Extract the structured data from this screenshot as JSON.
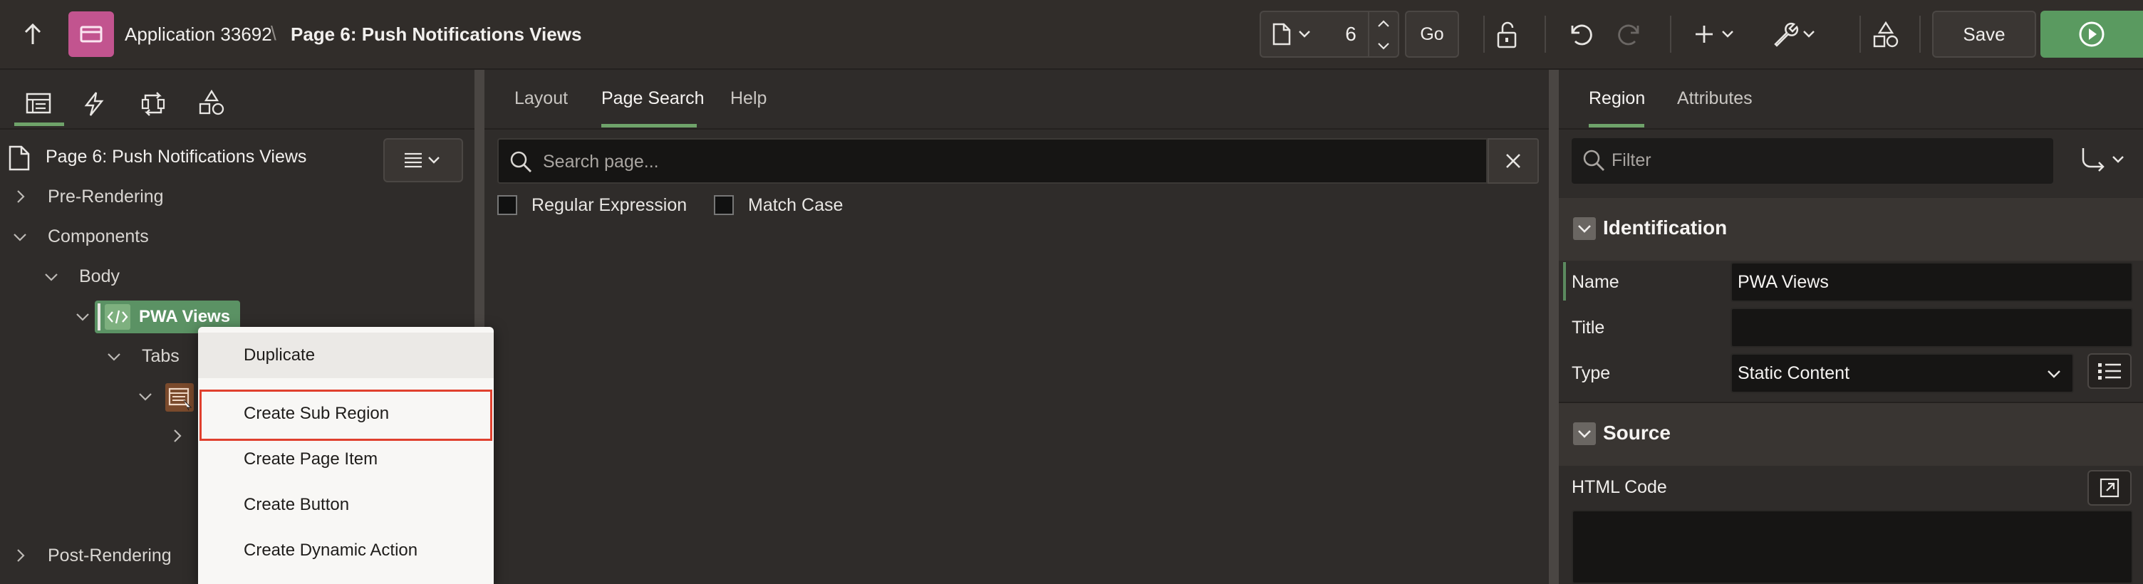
{
  "toolbar": {
    "app_title": "Application 33692",
    "breadcrumb_sep": "\\",
    "page_title": "Page 6: Push Notifications Views",
    "page_number": "6",
    "go_label": "Go",
    "save_label": "Save"
  },
  "left": {
    "tabs": [
      "rendering-icon",
      "dynamic-actions-icon",
      "processing-icon",
      "shared-components-icon"
    ],
    "page_node": "Page 6: Push Notifications Views",
    "tree": {
      "pre_rendering": "Pre-Rendering",
      "components": "Components",
      "body": "Body",
      "pwa_views": "PWA Views",
      "tabs": "Tabs",
      "post_rendering": "Post-Rendering"
    }
  },
  "context_menu": {
    "items": [
      "Duplicate",
      "Create Sub Region",
      "Create Page Item",
      "Create Button",
      "Create Dynamic Action"
    ],
    "highlighted": "Create Sub Region"
  },
  "middle": {
    "tabs": [
      "Layout",
      "Page Search",
      "Help"
    ],
    "active_tab": "Page Search",
    "search_placeholder": "Search page...",
    "regex_label": "Regular Expression",
    "match_case_label": "Match Case"
  },
  "right": {
    "tabs": [
      "Region",
      "Attributes"
    ],
    "active_tab": "Region",
    "filter_placeholder": "Filter",
    "identification": {
      "title": "Identification",
      "name_label": "Name",
      "name_value": "PWA Views",
      "title_label": "Title",
      "title_value": "",
      "type_label": "Type",
      "type_value": "Static Content"
    },
    "source": {
      "title": "Source",
      "html_code_label": "HTML Code",
      "html_code_value": ""
    }
  },
  "colors": {
    "accent_green": "#6fa36a",
    "run_button": "#5a9a60",
    "app_icon": "#c2548f",
    "highlight_border": "#e0402e"
  }
}
